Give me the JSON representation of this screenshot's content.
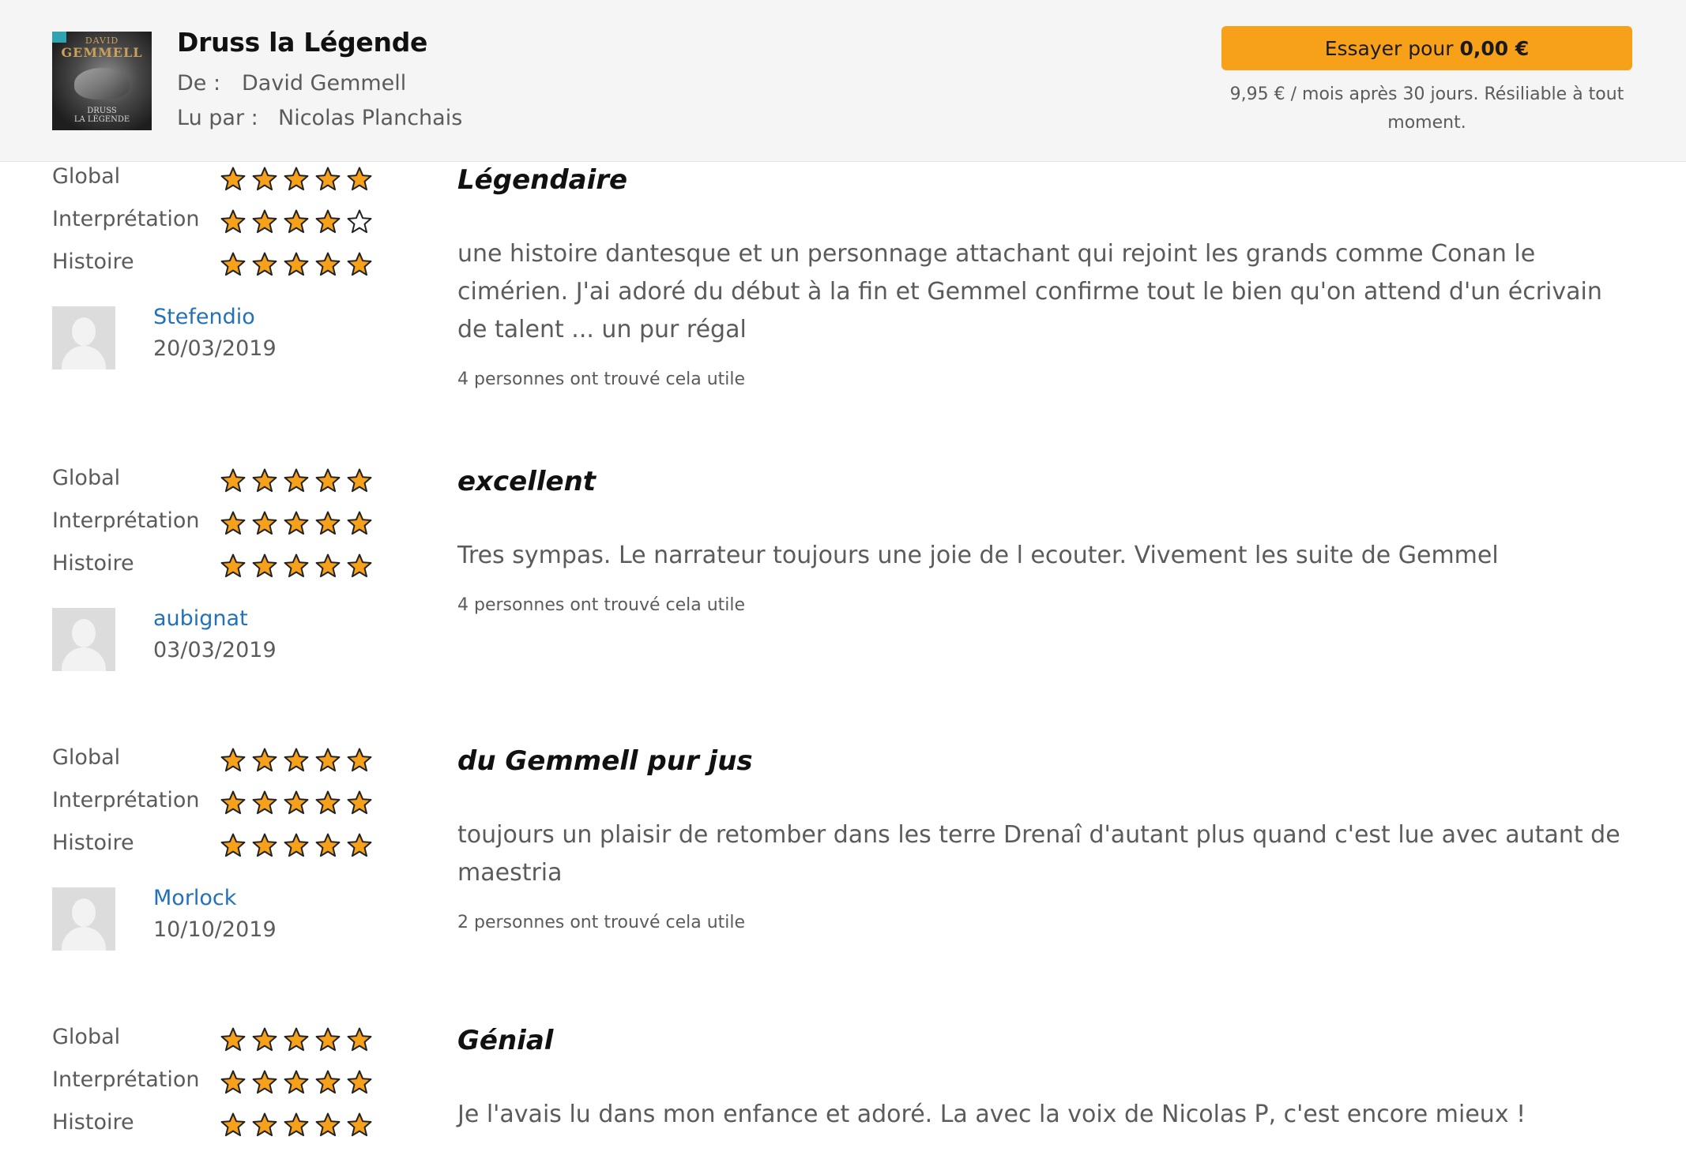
{
  "header": {
    "cover": {
      "author_small": "DAVID",
      "author_large": "GEMMELL",
      "title_line1": "DRUSS",
      "title_line2": "LA LÉGENDE"
    },
    "title": "Druss la Légende",
    "author_label": "De :",
    "author": "David Gemmell",
    "narrator_label": "Lu par :",
    "narrator": "Nicolas Planchais",
    "cta_prefix": "Essayer pour",
    "cta_price": "0,00 €",
    "cta_note": "9,95 € / mois après 30 jours. Résiliable à tout moment."
  },
  "labels": {
    "global": "Global",
    "performance": "Interprétation",
    "story": "Histoire"
  },
  "colors": {
    "star_fill": "#f7a11a",
    "star_outline": "#222222",
    "link": "#2371b8",
    "cta": "#f7a11a"
  },
  "reviews": [
    {
      "ratings": {
        "global": 5,
        "performance": 4,
        "story": 5
      },
      "reviewer": "Stefendio",
      "date": "20/03/2019",
      "title": "Légendaire",
      "body": "une histoire dantesque et un personnage attachant qui rejoint les grands comme Conan le cimérien. J'ai adoré du début à la fin et Gemmel confirme tout le bien qu'on attend d'un écrivain de talent ... un pur régal",
      "helpful": "4 personnes ont trouvé cela utile"
    },
    {
      "ratings": {
        "global": 5,
        "performance": 5,
        "story": 5
      },
      "reviewer": "aubignat",
      "date": "03/03/2019",
      "title": "excellent",
      "body": "Tres sympas. Le narrateur toujours une joie de l ecouter. Vivement les suite de Gemmel",
      "helpful": "4 personnes ont trouvé cela utile"
    },
    {
      "ratings": {
        "global": 5,
        "performance": 5,
        "story": 5
      },
      "reviewer": "Morlock",
      "date": "10/10/2019",
      "title": "du Gemmell pur jus",
      "body": "toujours un plaisir de retomber dans les terre Drenaî d'autant plus quand c'est lue avec autant de maestria",
      "helpful": "2 personnes ont trouvé cela utile"
    },
    {
      "ratings": {
        "global": 5,
        "performance": 5,
        "story": 5
      },
      "title": "Génial",
      "body": "Je l'avais lu dans mon enfance et adoré. La avec la voix de Nicolas P, c'est encore mieux !"
    }
  ]
}
